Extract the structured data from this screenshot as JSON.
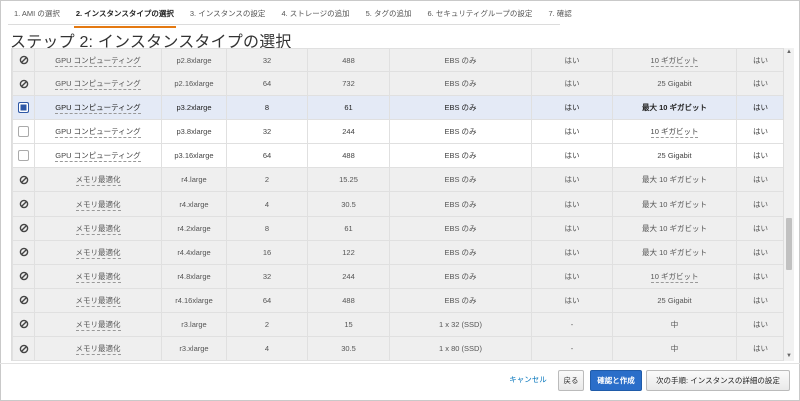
{
  "steps": [
    {
      "label": "1. AMI の選択",
      "active": false
    },
    {
      "label": "2. インスタンスタイプの選択",
      "active": true
    },
    {
      "label": "3. インスタンスの設定",
      "active": false
    },
    {
      "label": "4. ストレージの追加",
      "active": false
    },
    {
      "label": "5. タグの追加",
      "active": false
    },
    {
      "label": "6. セキュリティグループの設定",
      "active": false
    },
    {
      "label": "7. 確認",
      "active": false
    }
  ],
  "page_title": "ステップ 2: インスタンスタイプの選択",
  "rows": [
    {
      "state": "blocked",
      "family": "GPU コンピューティング",
      "type": "p2.8xlarge",
      "vcpu": "32",
      "mem": "488",
      "storage": "EBS のみ",
      "ebs": "はい",
      "net": "10 ギガビット",
      "net_dotted": true,
      "ipv6": "はい"
    },
    {
      "state": "blocked",
      "family": "GPU コンピューティング",
      "type": "p2.16xlarge",
      "vcpu": "64",
      "mem": "732",
      "storage": "EBS のみ",
      "ebs": "はい",
      "net": "25 Gigabit",
      "net_dotted": false,
      "ipv6": "はい"
    },
    {
      "state": "selected",
      "family": "GPU コンピューティング",
      "type": "p3.2xlarge",
      "vcpu": "8",
      "mem": "61",
      "storage": "EBS のみ",
      "ebs": "はい",
      "net": "最大 10 ギガビット",
      "net_dotted": false,
      "ipv6": "はい"
    },
    {
      "state": "available",
      "family": "GPU コンピューティング",
      "type": "p3.8xlarge",
      "vcpu": "32",
      "mem": "244",
      "storage": "EBS のみ",
      "ebs": "はい",
      "net": "10 ギガビット",
      "net_dotted": true,
      "ipv6": "はい"
    },
    {
      "state": "available",
      "family": "GPU コンピューティング",
      "type": "p3.16xlarge",
      "vcpu": "64",
      "mem": "488",
      "storage": "EBS のみ",
      "ebs": "はい",
      "net": "25 Gigabit",
      "net_dotted": false,
      "ipv6": "はい"
    },
    {
      "state": "blocked",
      "family": "メモリ最適化",
      "type": "r4.large",
      "vcpu": "2",
      "mem": "15.25",
      "storage": "EBS のみ",
      "ebs": "はい",
      "net": "最大 10 ギガビット",
      "net_dotted": false,
      "ipv6": "はい"
    },
    {
      "state": "blocked",
      "family": "メモリ最適化",
      "type": "r4.xlarge",
      "vcpu": "4",
      "mem": "30.5",
      "storage": "EBS のみ",
      "ebs": "はい",
      "net": "最大 10 ギガビット",
      "net_dotted": false,
      "ipv6": "はい"
    },
    {
      "state": "blocked",
      "family": "メモリ最適化",
      "type": "r4.2xlarge",
      "vcpu": "8",
      "mem": "61",
      "storage": "EBS のみ",
      "ebs": "はい",
      "net": "最大 10 ギガビット",
      "net_dotted": false,
      "ipv6": "はい"
    },
    {
      "state": "blocked",
      "family": "メモリ最適化",
      "type": "r4.4xlarge",
      "vcpu": "16",
      "mem": "122",
      "storage": "EBS のみ",
      "ebs": "はい",
      "net": "最大 10 ギガビット",
      "net_dotted": false,
      "ipv6": "はい"
    },
    {
      "state": "blocked",
      "family": "メモリ最適化",
      "type": "r4.8xlarge",
      "vcpu": "32",
      "mem": "244",
      "storage": "EBS のみ",
      "ebs": "はい",
      "net": "10 ギガビット",
      "net_dotted": true,
      "ipv6": "はい"
    },
    {
      "state": "blocked",
      "family": "メモリ最適化",
      "type": "r4.16xlarge",
      "vcpu": "64",
      "mem": "488",
      "storage": "EBS のみ",
      "ebs": "はい",
      "net": "25 Gigabit",
      "net_dotted": false,
      "ipv6": "はい"
    },
    {
      "state": "blocked",
      "family": "メモリ最適化",
      "type": "r3.large",
      "vcpu": "2",
      "mem": "15",
      "storage": "1 x 32 (SSD)",
      "ebs": "-",
      "net": "中",
      "net_dotted": false,
      "ipv6": "はい"
    },
    {
      "state": "blocked",
      "family": "メモリ最適化",
      "type": "r3.xlarge",
      "vcpu": "4",
      "mem": "30.5",
      "storage": "1 x 80 (SSD)",
      "ebs": "-",
      "net": "中",
      "net_dotted": false,
      "ipv6": "はい"
    }
  ],
  "footer": {
    "cancel": "キャンセル",
    "back": "戻る",
    "review": "確認と作成",
    "next": "次の手順: インスタンスの詳細の設定"
  },
  "colors": {
    "accent": "#e47911",
    "primary_button": "#2a6ec9",
    "selected_row": "#e4eaf6",
    "disabled_row": "#efefef"
  }
}
